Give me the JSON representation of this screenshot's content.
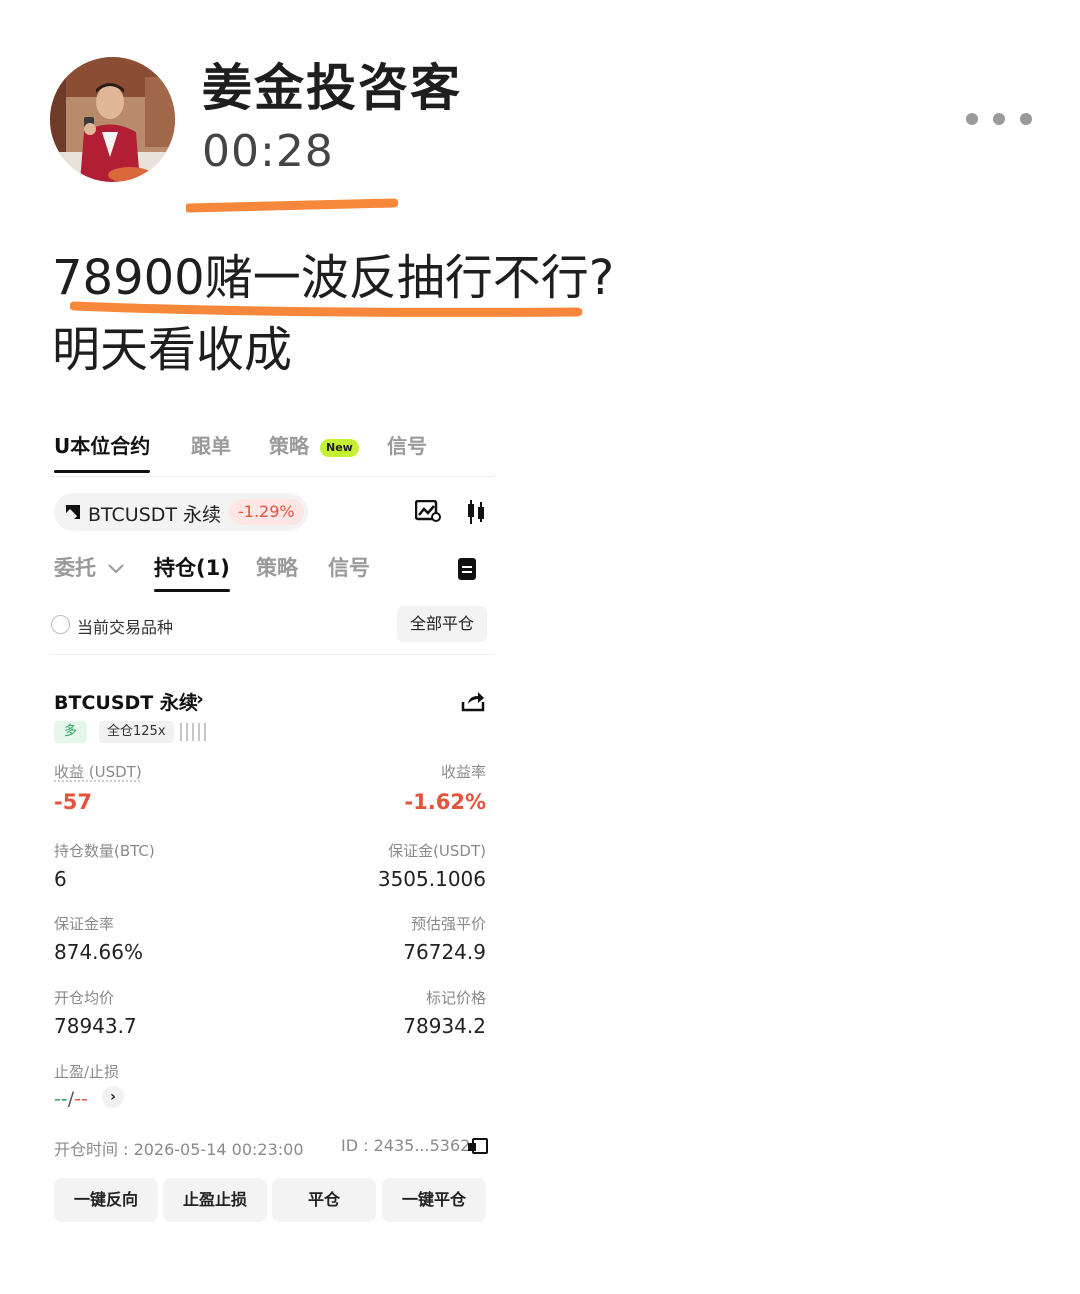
{
  "post": {
    "author_name": "姜金投咨客",
    "time": "00:28",
    "text_lines": [
      "78900赌一波反抽行不行?",
      "明天看收成"
    ]
  },
  "colors": {
    "highlight_orange": "#f7873a",
    "loss_red": "#e5533d",
    "long_green": "#27a35a",
    "new_badge": "#c4f233"
  },
  "app": {
    "top_tabs": [
      {
        "label": "U本位合约",
        "active": true
      },
      {
        "label": "跟单",
        "active": false
      },
      {
        "label": "策略",
        "active": false
      },
      {
        "label": "信号",
        "active": false
      }
    ],
    "new_badge": "New",
    "pair": {
      "label": "BTCUSDT 永续",
      "change": "-1.29%"
    },
    "sub_tabs": [
      {
        "label": "委托",
        "active": false
      },
      {
        "label": "持仓(1)",
        "active": true
      },
      {
        "label": "策略",
        "active": false
      },
      {
        "label": "信号",
        "active": false
      }
    ],
    "filter_label": "当前交易品种",
    "close_all_label": "全部平仓",
    "position": {
      "title": "BTCUSDT 永续",
      "side": "多",
      "leverage": "全仓125x",
      "pnl_label": "收益 (USDT)",
      "pnl_value": "-57",
      "roe_label": "收益率",
      "roe_value": "-1.62%",
      "size_label": "持仓数量(BTC)",
      "size_value": "6",
      "margin_label": "保证金(USDT)",
      "margin_value": "3505.1006",
      "margin_ratio_label": "保证金率",
      "margin_ratio_value": "874.66%",
      "liq_label": "预估强平价",
      "liq_value": "76724.9",
      "entry_label": "开仓均价",
      "entry_value": "78943.7",
      "mark_label": "标记价格",
      "mark_value": "78934.2",
      "tpsl_label": "止盈/止损",
      "tp_value": "--",
      "tpsl_sep": "/",
      "sl_value": "--",
      "open_time": "开仓时间 : 2026-05-14 00:23:00",
      "id": "ID : 2435...5362"
    },
    "actions": [
      "一键反向",
      "止盈止损",
      "平仓",
      "一键平仓"
    ]
  }
}
